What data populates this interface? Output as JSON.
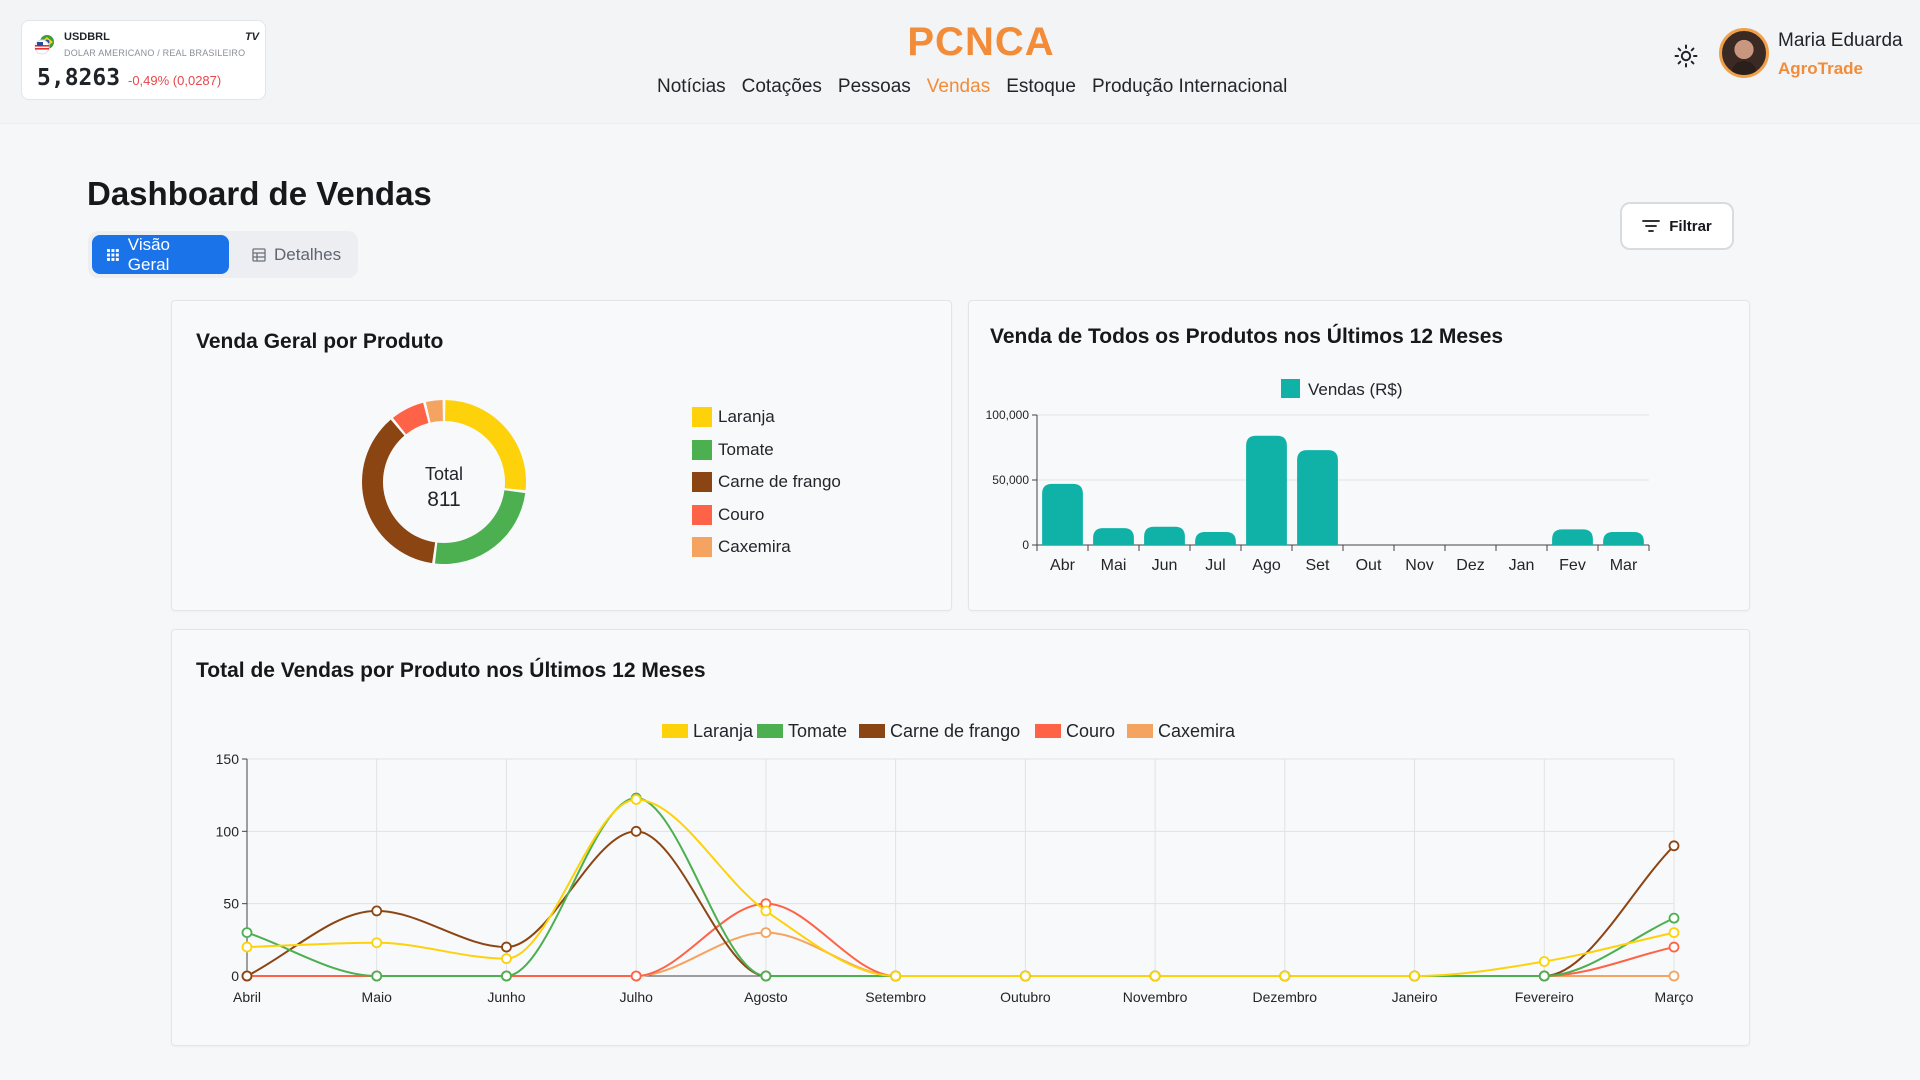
{
  "ticker": {
    "symbol": "USDBRL",
    "description": "DOLAR AMERICANO / REAL BRASILEIRO",
    "price": "5,8263",
    "change": "-0,49% (0,0287)",
    "provider_mark": "TV",
    "change_color": "#e5484d"
  },
  "header": {
    "brand": "PCNCA",
    "nav": [
      "Notícias",
      "Cotações",
      "Pessoas",
      "Vendas",
      "Estoque",
      "Produção Internacional"
    ],
    "active_nav": "Vendas",
    "theme_icon": "sun-icon",
    "user": {
      "name": "Maria Eduarda",
      "role": "AgroTrade"
    }
  },
  "colors": {
    "accent": "#f28c38",
    "primary": "#1a73e8",
    "teal": "#10b2a8"
  },
  "page": {
    "title": "Dashboard de Vendas",
    "tabs": [
      "Visão Geral",
      "Detalhes"
    ],
    "active_tab": "Visão Geral",
    "filter_label": "Filtrar"
  },
  "cards": {
    "donut": {
      "title": "Venda Geral por Produto",
      "center_label": "Total",
      "center_value": "811"
    },
    "bar": {
      "title": "Venda de Todos os Produtos nos Últimos 12 Meses"
    },
    "line": {
      "title": "Total de Vendas por Produto nos Últimos 12 Meses"
    }
  },
  "chart_data": [
    {
      "type": "pie",
      "variant": "donut",
      "title": "Venda Geral por Produto",
      "categories": [
        "Laranja",
        "Tomate",
        "Carne de frango",
        "Couro",
        "Caxemira"
      ],
      "values": [
        218,
        204,
        300,
        58,
        31
      ],
      "colors": [
        "#fdd20a",
        "#4caf50",
        "#8b4513",
        "#ff6347",
        "#f4a460"
      ],
      "legend_position": "right"
    },
    {
      "type": "bar",
      "title": "Venda de Todos os Produtos nos Últimos 12 Meses",
      "legend": "Vendas (R$)",
      "categories": [
        "Abr",
        "Mai",
        "Jun",
        "Jul",
        "Ago",
        "Set",
        "Out",
        "Nov",
        "Dez",
        "Jan",
        "Fev",
        "Mar"
      ],
      "values": [
        47000,
        13000,
        14000,
        10000,
        84000,
        73000,
        0,
        0,
        0,
        0,
        12000,
        10000
      ],
      "y_ticks": [
        "0",
        "50,000",
        "100,000"
      ],
      "ylim": [
        0,
        100000
      ],
      "color": "#10b2a8",
      "legend_position": "top"
    },
    {
      "type": "line",
      "title": "Total de Vendas por Produto nos Últimos 12 Meses",
      "x": [
        "Abril",
        "Maio",
        "Junho",
        "Julho",
        "Agosto",
        "Setembro",
        "Outubro",
        "Novembro",
        "Dezembro",
        "Janeiro",
        "Fevereiro",
        "Março"
      ],
      "series": [
        {
          "name": "Laranja",
          "color": "#fdd20a",
          "values": [
            20,
            23,
            12,
            122,
            45,
            0,
            0,
            0,
            0,
            0,
            10,
            30
          ]
        },
        {
          "name": "Tomate",
          "color": "#4caf50",
          "values": [
            30,
            0,
            0,
            123,
            0,
            0,
            0,
            0,
            0,
            0,
            0,
            40
          ]
        },
        {
          "name": "Carne de frango",
          "color": "#8b4513",
          "values": [
            0,
            45,
            20,
            100,
            0,
            0,
            0,
            0,
            0,
            0,
            0,
            90
          ]
        },
        {
          "name": "Couro",
          "color": "#ff6347",
          "values": [
            0,
            0,
            0,
            0,
            50,
            0,
            0,
            0,
            0,
            0,
            0,
            20
          ]
        },
        {
          "name": "Caxemira",
          "color": "#f4a460",
          "values": [
            0,
            0,
            0,
            0,
            30,
            0,
            0,
            0,
            0,
            0,
            0,
            0
          ]
        }
      ],
      "y_ticks": [
        "0",
        "50",
        "100",
        "150"
      ],
      "ylim": [
        0,
        150
      ],
      "grid": true,
      "legend_position": "top"
    }
  ]
}
